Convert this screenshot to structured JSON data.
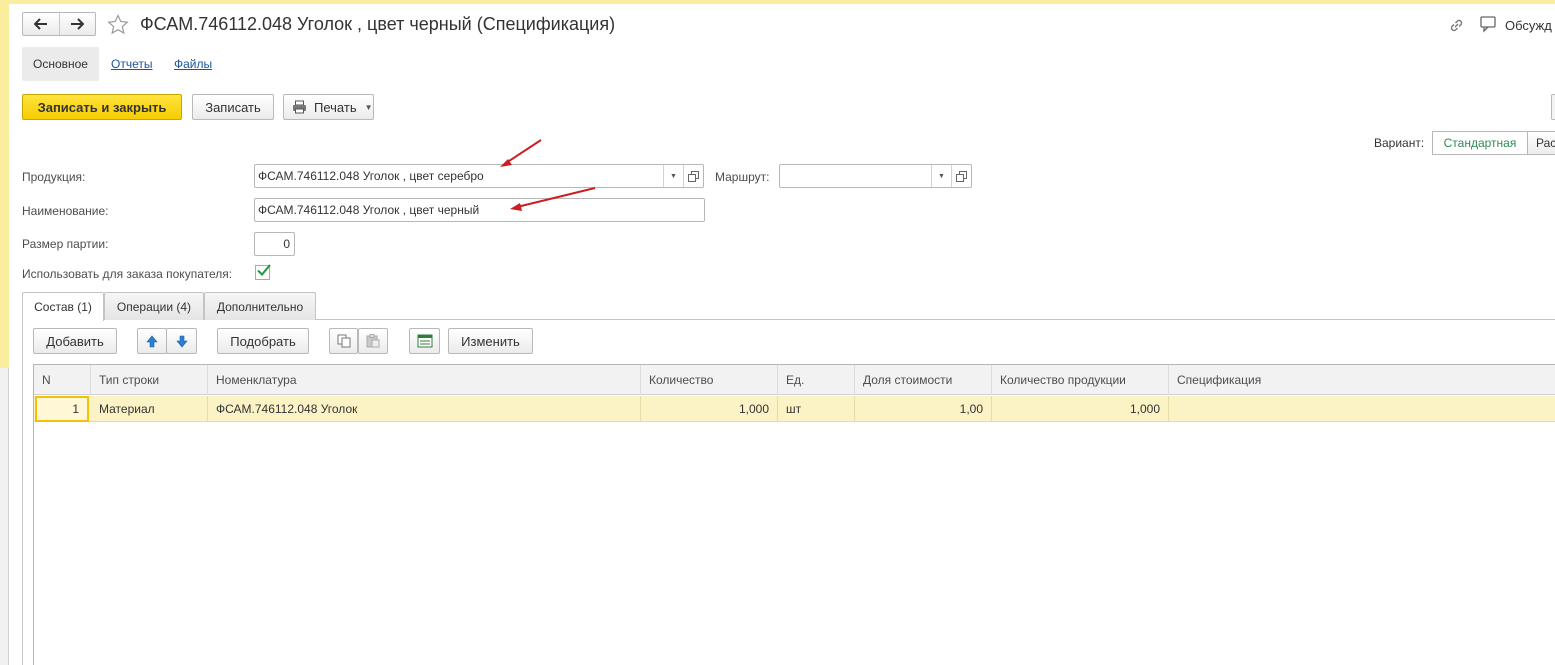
{
  "window": {
    "title": "ФСАМ.746112.048 Уголок , цвет черный (Спецификация)",
    "discuss_label": "Обсужд"
  },
  "nav_tabs": [
    {
      "label": "Основное",
      "active": true
    },
    {
      "label": "Отчеты",
      "active": false
    },
    {
      "label": "Файлы",
      "active": false
    }
  ],
  "toolbar": {
    "save_close_label": "Записать и закрыть",
    "save_label": "Записать",
    "print_label": "Печать"
  },
  "variant": {
    "label": "Вариант:",
    "options": [
      "Стандартная",
      "Рас"
    ]
  },
  "form": {
    "product_label": "Продукция:",
    "product_value": "ФСАМ.746112.048 Уголок , цвет серебро",
    "route_label": "Маршрут:",
    "route_value": "",
    "name_label": "Наименование:",
    "name_value": "ФСАМ.746112.048 Уголок , цвет черный",
    "batch_label": "Размер партии:",
    "batch_value": "0",
    "use_for_order_label": "Использовать для заказа покупателя:",
    "use_for_order_checked": true
  },
  "section_tabs": [
    {
      "label": "Состав (1)",
      "active": true
    },
    {
      "label": "Операции (4)",
      "active": false
    },
    {
      "label": "Дополнительно",
      "active": false
    }
  ],
  "table_toolbar": {
    "add_label": "Добавить",
    "pick_label": "Подобрать",
    "change_label": "Изменить"
  },
  "table": {
    "columns": [
      "N",
      "Тип строки",
      "Номенклатура",
      "Количество",
      "Ед.",
      "Доля стоимости",
      "Количество продукции",
      "Спецификация"
    ],
    "rows": [
      {
        "n": "1",
        "type": "Материал",
        "nomenclature": "ФСАМ.746112.048 Уголок",
        "qty": "1,000",
        "unit": "шт",
        "share": "1,00",
        "product_qty": "1,000",
        "spec": ""
      }
    ]
  },
  "colors": {
    "accent_yellow": "#f5cd00",
    "selected_row": "#fbf2c6",
    "link": "#1b53a0",
    "variant_active": "#2e8b57",
    "arrow_red": "#cc1f1f"
  }
}
